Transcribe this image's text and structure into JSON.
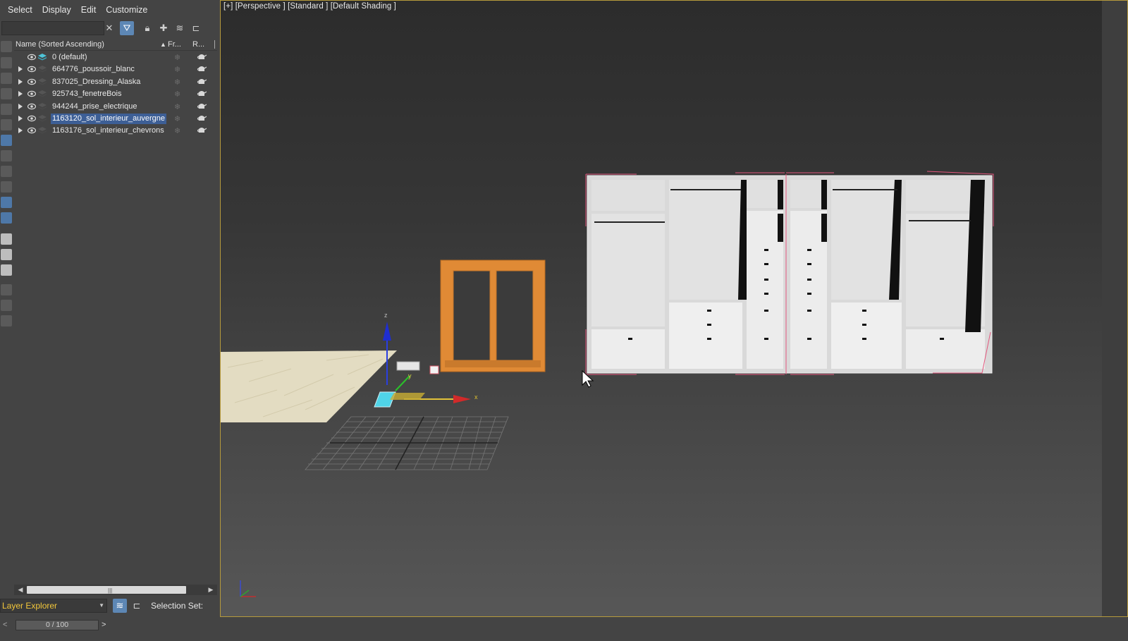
{
  "menu": [
    "Select",
    "Display",
    "Edit",
    "Customize"
  ],
  "toolbar": {
    "search_value": "",
    "icons": [
      "clear-icon",
      "filter-icon",
      "lock-icon",
      "add-layer-icon",
      "layers-icon",
      "hierarchy-icon"
    ]
  },
  "tree": {
    "header": {
      "name": "Name (Sorted Ascending)",
      "sort_glyph": "▲",
      "freeze": "Fr...",
      "render": "R..."
    },
    "rows": [
      {
        "label": "0 (default)",
        "expandable": false,
        "selected": false
      },
      {
        "label": "664776_poussoir_blanc",
        "expandable": true,
        "selected": false
      },
      {
        "label": "837025_Dressing_Alaska",
        "expandable": true,
        "selected": false
      },
      {
        "label": "925743_fenetreBois",
        "expandable": true,
        "selected": false
      },
      {
        "label": "944244_prise_electrique",
        "expandable": true,
        "selected": false
      },
      {
        "label": "1163120_sol_interieur_auvergne",
        "expandable": true,
        "selected": true
      },
      {
        "label": "1163176_sol_interieur_chevrons",
        "expandable": true,
        "selected": false
      }
    ]
  },
  "bottom": {
    "explorer": "Layer Explorer",
    "selection_set_label": "Selection Set:"
  },
  "timeline": {
    "value": "0 / 100",
    "prev": "<",
    "next": ">"
  },
  "viewport": {
    "label": "[+] [Perspective ] [Standard ] [Default Shading ]",
    "axis_labels": {
      "x": "x",
      "y": "y",
      "z": "z"
    }
  },
  "colors": {
    "accent_blue": "#5d87b5",
    "selection": "#3d5f96",
    "viewport_border": "#b69a3c",
    "window_frame": "#e08a35"
  }
}
